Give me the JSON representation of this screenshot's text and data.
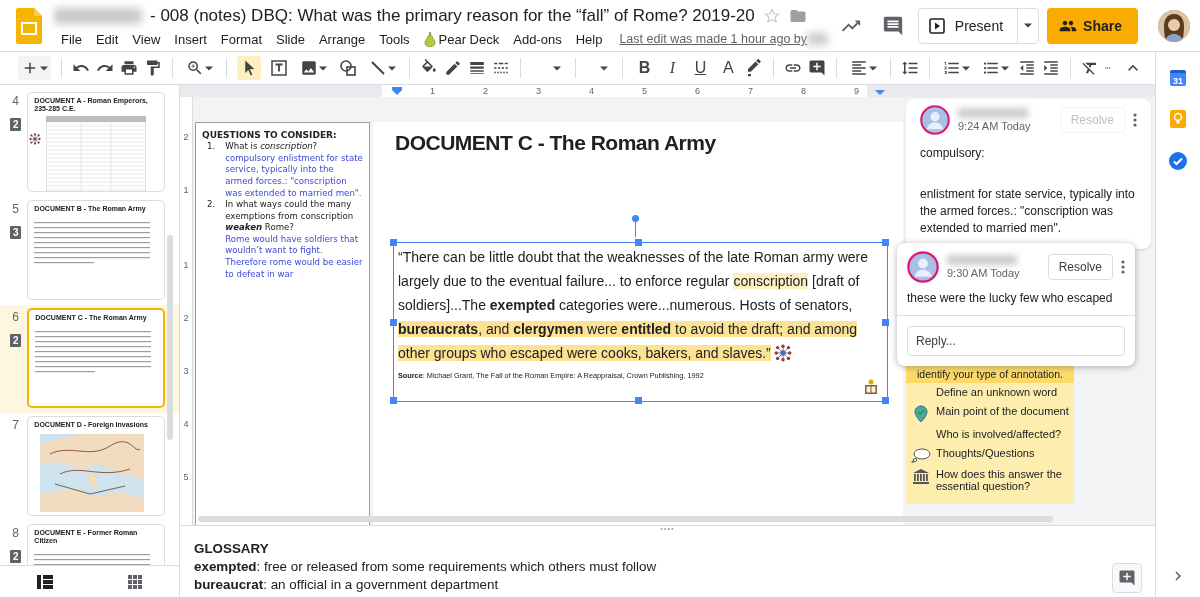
{
  "header": {
    "title": "- 008 (notes) DBQ: What was the primary reason for the “fall” of Rome? 2019-20",
    "menu": [
      "File",
      "Edit",
      "View",
      "Insert",
      "Format",
      "Slide",
      "Arrange",
      "Tools",
      "Pear Deck",
      "Add-ons",
      "Help"
    ],
    "last_edit": "Last edit was made 1 hour ago by",
    "present": "Present",
    "share": "Share"
  },
  "toolbar": {
    "tools": [
      {
        "selected": true
      },
      {
        "selected": false
      },
      {
        "selected": false
      },
      {
        "selected": false
      },
      {
        "selected": false
      }
    ],
    "format_buttons": [
      "B",
      "I",
      "U",
      "A"
    ]
  },
  "ruler": {
    "ticks": [
      "1",
      "2",
      "3",
      "4",
      "5",
      "6",
      "7",
      "8",
      "9"
    ]
  },
  "vertical_ruler": {
    "above": [
      "2",
      "1"
    ],
    "below": [
      "1",
      "2",
      "3",
      "4",
      "5"
    ]
  },
  "filmstrip": [
    {
      "number": "4",
      "comments": "2",
      "selected": false,
      "kind": "table",
      "title": "DOCUMENT A - Roman Emperors, 235-285 C.E."
    },
    {
      "number": "5",
      "comments": "3",
      "selected": false,
      "kind": "text",
      "title": "DOCUMENT B - The Roman Army"
    },
    {
      "number": "6",
      "comments": "2",
      "selected": true,
      "kind": "text",
      "title": "DOCUMENT C - The Roman Army"
    },
    {
      "number": "7",
      "selected": false,
      "kind": "map",
      "title": "DOCUMENT D - Foreign Invasions"
    },
    {
      "number": "8",
      "comments": "2",
      "selected": false,
      "kind": "text",
      "title": "DOCUMENT E - Former Roman Citizen"
    }
  ],
  "questions": {
    "heading": "QUESTIONS TO CONSIDER:",
    "items": [
      {
        "number": "1.",
        "question": "What is *conscription*?",
        "answer": "compulsory enlistment for state service, typically into the armed forces.: \"conscription was extended to married men\"."
      },
      {
        "number": "2.",
        "question": "In what ways could the many exemptions from conscription **weaken** Rome?",
        "answer": "Rome would have soldiers that wouldn’t want to fight. Therefore rome would be easier to defeat in war"
      }
    ]
  },
  "slide": {
    "title": "DOCUMENT C - The Roman Army",
    "quote": [
      {
        "text": "“There can be little doubt that the weaknesses of the late Roman army were largely due to the eventual failure... to enforce regular "
      },
      {
        "text": "conscription",
        "color": "#feefc3"
      },
      {
        "text": " [draft of soldiers]...The **exempted** categories were...numerous. Hosts of senators, "
      },
      {
        "text": "**bureaucrats**, and **clergymen** were **entitled** to avoid the draft; and among other groups who escaped were cooks, bakers, and slaves.”",
        "color": "#fde293"
      }
    ],
    "source": "**Source**: Michael Grant, The Fall of the Roman Empire: A Reappraisal, Crown Publishing, 1992"
  },
  "comments": [
    {
      "time": "9:24 AM Today",
      "resolve": "Resolve",
      "disabled": true,
      "paragraphs": [
        "compulsory:",
        "enlistment for state service, typically into the armed forces.: \"conscription was extended to married men\"."
      ]
    }
  ],
  "popup_comment": {
    "time": "9:30 AM Today",
    "resolve": "Resolve",
    "disabled": false,
    "text": "these were the lucky few who escaped",
    "reply_placeholder": "Reply..."
  },
  "legend": {
    "heading": "identify your type of annotation.",
    "items": [
      {
        "label": "Define an unknown word",
        "kind": "plain"
      },
      {
        "label": "Main point of the document",
        "kind": "pin"
      },
      {
        "label": "Who is involved/affected?",
        "kind": "plain"
      },
      {
        "label": "Thoughts/Questions",
        "kind": "bubble"
      },
      {
        "label": "How does this answer the essential question?",
        "kind": "building"
      }
    ]
  },
  "notes": {
    "heading": "GLOSSARY",
    "lines": [
      "**exempted**: free or released from some requirements which others must follow",
      "**bureaucrat**: an official in a government department"
    ]
  },
  "side_panel": {
    "calendar_day": "31"
  }
}
